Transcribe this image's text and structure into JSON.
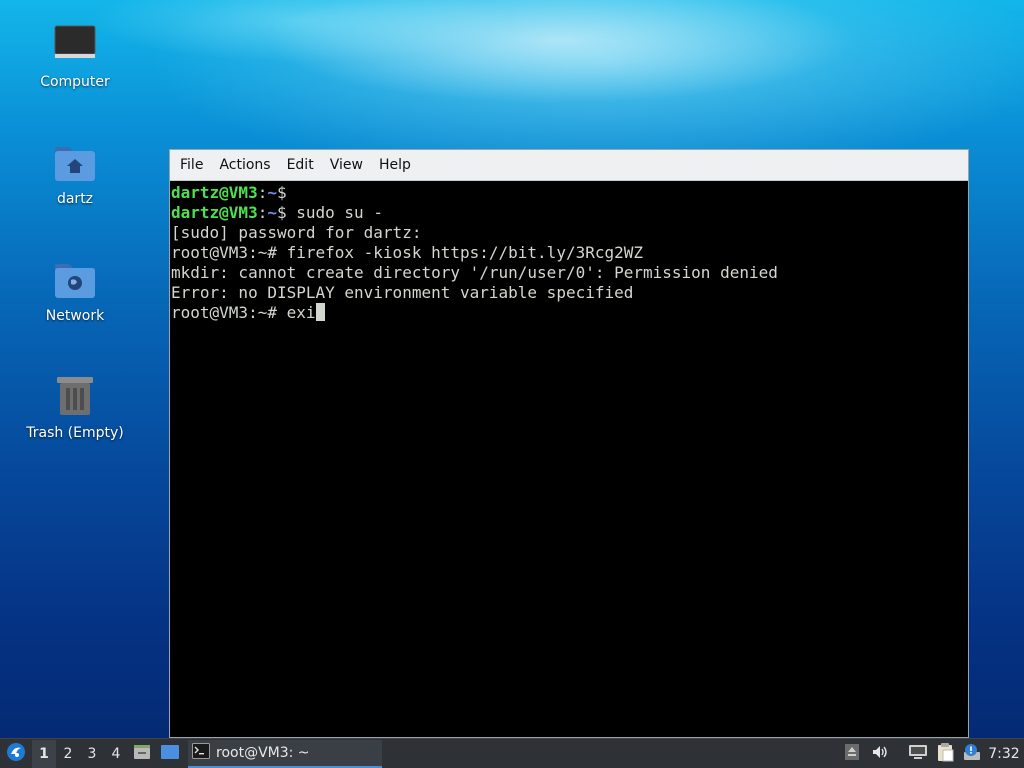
{
  "desktop": {
    "icons": [
      {
        "label": "Computer"
      },
      {
        "label": "dartz"
      },
      {
        "label": "Network"
      },
      {
        "label": "Trash (Empty)"
      }
    ]
  },
  "terminal": {
    "menu": [
      "File",
      "Actions",
      "Edit",
      "View",
      "Help"
    ],
    "lines": {
      "l1": {
        "user": "dartz@VM3",
        "sep": ":",
        "path": "~",
        "rest": "$"
      },
      "l2": {
        "user": "dartz@VM3",
        "sep": ":",
        "path": "~",
        "rest": "$ sudo su -"
      },
      "l3": "[sudo] password for dartz:",
      "l4": "root@VM3:~# firefox -kiosk https://bit.ly/3Rcg2WZ",
      "l5": "mkdir: cannot create directory '/run/user/0': Permission denied",
      "l6": "Error: no DISPLAY environment variable specified",
      "l7": "root@VM3:~# exi"
    }
  },
  "taskbar": {
    "workspaces": [
      "1",
      "2",
      "3",
      "4"
    ],
    "active_workspace": "1",
    "task_label": "root@VM3: ~",
    "clock": "7:32"
  },
  "colors": {
    "prompt_user": "#4ee04e",
    "prompt_path": "#6f8fef",
    "taskbar_bg": "#2e3237",
    "accent": "#4a90d9"
  }
}
